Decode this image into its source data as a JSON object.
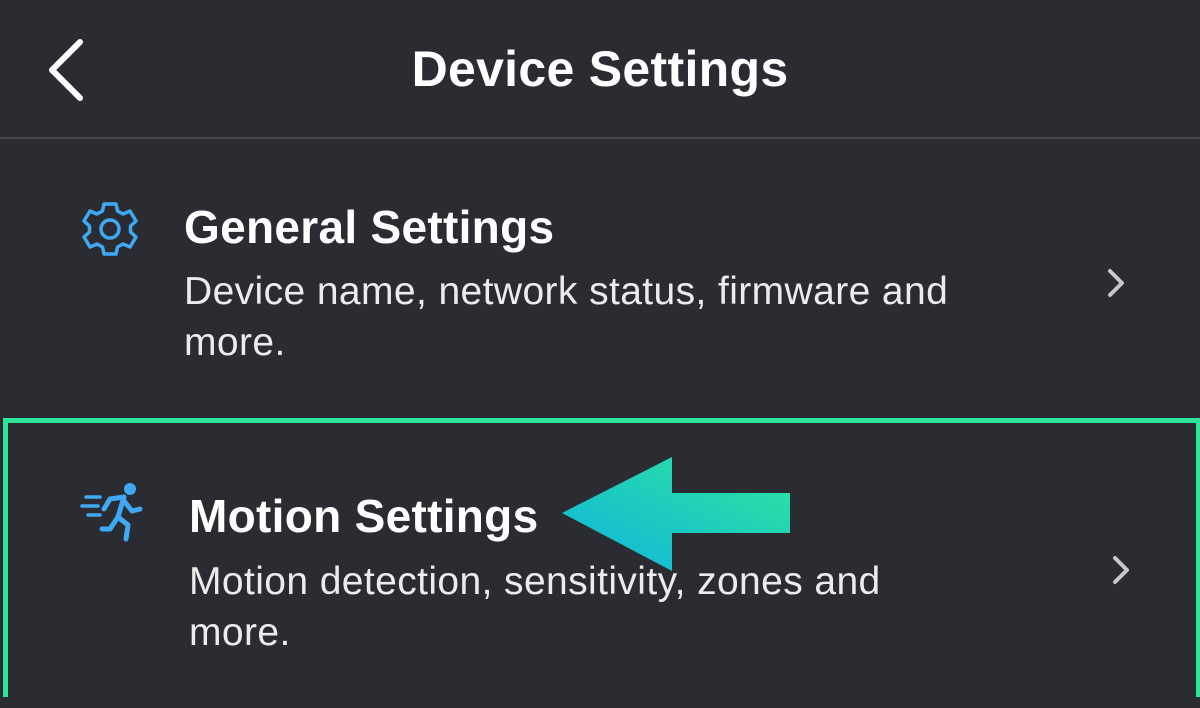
{
  "header": {
    "title": "Device Settings",
    "back_icon": "chevron-left-icon"
  },
  "rows": [
    {
      "title": "General Settings",
      "description": "Device name, network status, firmware and more.",
      "icon": "gear-icon",
      "icon_color": "#3fa9f5"
    },
    {
      "title": "Motion Settings",
      "description": "Motion detection, sensitivity, zones and more.",
      "icon": "running-person-icon",
      "icon_color": "#3fa9f5",
      "highlighted": true
    }
  ],
  "colors": {
    "background": "#2a2c31",
    "highlight_border": "#2ee69b",
    "arrow_gradient_start": "#2ee69b",
    "arrow_gradient_end": "#0fb4e0"
  },
  "annotation": {
    "arrow_icon": "arrow-left-icon"
  }
}
